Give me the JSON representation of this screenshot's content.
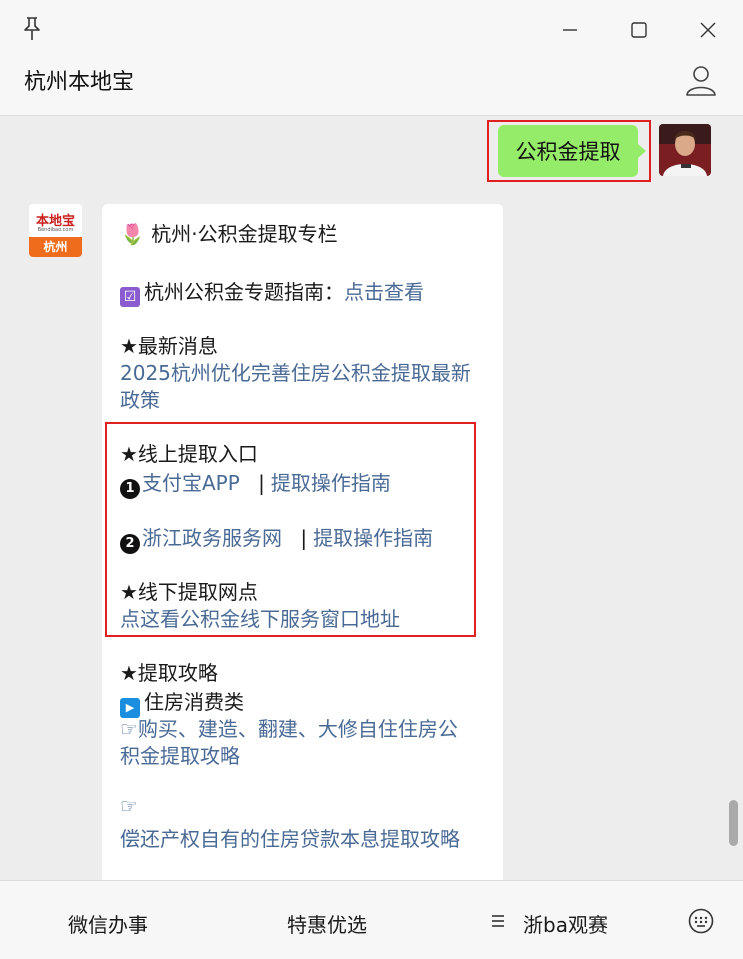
{
  "window": {
    "pin_icon": "pin-icon",
    "minimize_icon": "minimize-icon",
    "maximize_icon": "maximize-icon",
    "close_icon": "close-icon"
  },
  "header": {
    "title": "杭州本地宝",
    "profile_icon": "user-icon"
  },
  "outgoing": {
    "text": "公积金提取",
    "bubble_color": "#95ec69"
  },
  "bot": {
    "brand": "本地宝",
    "url": "Bendibao.com",
    "city": "杭州"
  },
  "card": {
    "title_icon": "🌷",
    "title": "杭州·公积金提取专栏",
    "guide_check": "☑",
    "guide_label": "杭州公积金专题指南：",
    "guide_link": "点击查看",
    "news_heading": "★最新消息",
    "news_link_line1": "2025杭州优化完善住房公积金提取最新",
    "news_link_line2": "政策",
    "online_heading": "★线上提取入口",
    "online1_num": "1",
    "online1_link": "支付宝APP",
    "separator": "|",
    "online1_guide": "提取操作指南",
    "online2_num": "2",
    "online2_link": "浙江政务服务网",
    "online2_guide": "提取操作指南",
    "offline_heading": "★线下提取网点",
    "offline_link": "点这看公积金线下服务窗口地址",
    "strategy_heading": "★提取攻略",
    "housing_label": "住房消费类",
    "housing_play_icon": "▶",
    "pointer": "☞",
    "strategy1_line1": "购买、建造、翻建、大修自住住房公",
    "strategy1_line2": "积金提取攻略",
    "strategy2": "偿还产权自有的住房贷款本息提取攻略",
    "link_color": "#4a6a96"
  },
  "bottom": {
    "menu1": "微信办事",
    "menu2": "特惠优选",
    "menu3": "浙ba观赛",
    "menu3_icon": "list-icon",
    "keyboard_icon": "keyboard-icon"
  }
}
